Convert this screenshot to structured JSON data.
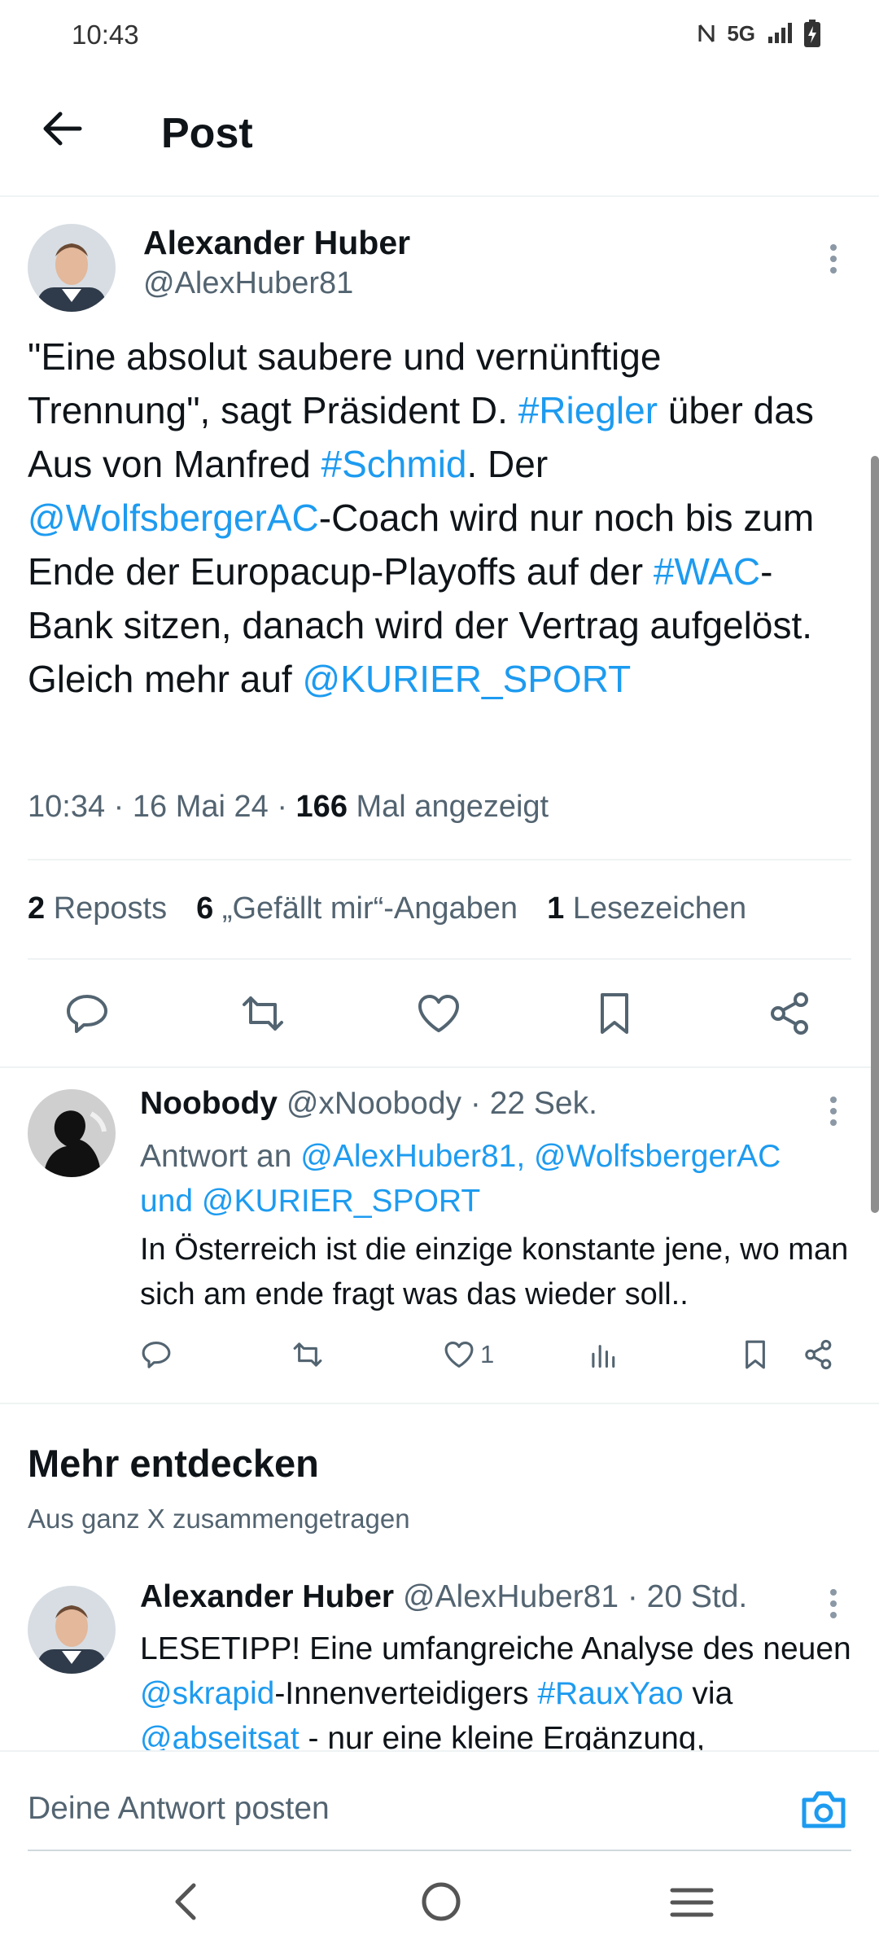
{
  "status_bar": {
    "time": "10:43",
    "network": "5G"
  },
  "header": {
    "title": "Post"
  },
  "post": {
    "author_name": "Alexander Huber",
    "author_handle": "@AlexHuber81",
    "text_segments": [
      {
        "t": "\"Eine absolut saubere und vernünftige Trennung\", sagt Präsident D. ",
        "link": false
      },
      {
        "t": "#Riegler",
        "link": true
      },
      {
        "t": " über das Aus von Manfred ",
        "link": false
      },
      {
        "t": "#Schmid",
        "link": true
      },
      {
        "t": ". Der ",
        "link": false
      },
      {
        "t": "@WolfsbergerAC",
        "link": true
      },
      {
        "t": "-Coach wird nur noch bis zum Ende der Europacup-Playoffs auf der ",
        "link": false
      },
      {
        "t": "#WAC",
        "link": true
      },
      {
        "t": "-Bank sitzen, danach wird der Vertrag aufgelöst. Gleich mehr auf ",
        "link": false
      },
      {
        "t": "@KURIER_SPORT",
        "link": true
      }
    ],
    "meta": {
      "time": "10:34",
      "date": "16 Mai 24",
      "views_count": "166",
      "views_label": "Mal angezeigt"
    },
    "stats": {
      "reposts_count": "2",
      "reposts_label": "Reposts",
      "likes_count": "6",
      "likes_label": "„Gefällt mir“-Angaben",
      "bookmarks_count": "1",
      "bookmarks_label": "Lesezeichen"
    }
  },
  "reply": {
    "author_name": "Noobody",
    "author_handle": "@xNoobody",
    "time": "· 22 Sek.",
    "reply_to_prefix": "Antwort an",
    "reply_to_users": "@AlexHuber81, @WolfsbergerAC und @KURIER_SPORT",
    "text": "In Österreich ist die einzige konstante jene, wo man sich  am ende fragt was das wieder soll..",
    "like_count": "1"
  },
  "discover": {
    "title": "Mehr entdecken",
    "subtitle": "Aus ganz X zusammengetragen",
    "item": {
      "author_name": "Alexander Huber",
      "author_handle": "@AlexHuber81",
      "time": "· 20 Std.",
      "text_segments": [
        {
          "t": "LESETIPP! Eine umfangreiche Analyse des neuen ",
          "link": false
        },
        {
          "t": "@skrapid",
          "link": true
        },
        {
          "t": "-Innenverteidigers ",
          "link": false
        },
        {
          "t": "#RauxYao",
          "link": true
        },
        {
          "t": " via ",
          "link": false
        },
        {
          "t": "@abseitsat",
          "link": true
        },
        {
          "t": " - nur eine kleine Ergänzung,",
          "link": false
        }
      ]
    }
  },
  "composer": {
    "placeholder": "Deine Antwort posten"
  },
  "colors": {
    "link": "#1d9bf0",
    "secondary": "#536471",
    "divider": "#eff3f4"
  }
}
